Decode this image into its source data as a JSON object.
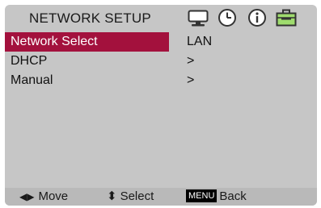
{
  "header": {
    "title": "NETWORK SETUP",
    "icons": [
      "monitor-icon",
      "clock-icon",
      "info-icon",
      "toolbox-icon"
    ]
  },
  "menu": {
    "rows": [
      {
        "label": "Network Select",
        "value": "LAN",
        "selected": true
      },
      {
        "label": "DHCP",
        "value": ">",
        "selected": false
      },
      {
        "label": "Manual",
        "value": ">",
        "selected": false
      }
    ]
  },
  "footer": {
    "move_glyph": "◀▶",
    "move_label": "Move",
    "select_glyph": "⬍",
    "select_label": "Select",
    "menu_chip": "MENU",
    "back_label": "Back"
  },
  "colors": {
    "selected_bg": "#a3113d",
    "panel_bg": "#c6c6c6",
    "footer_bg": "#b9b9b9",
    "toolbox_green": "#9fdc6e"
  }
}
